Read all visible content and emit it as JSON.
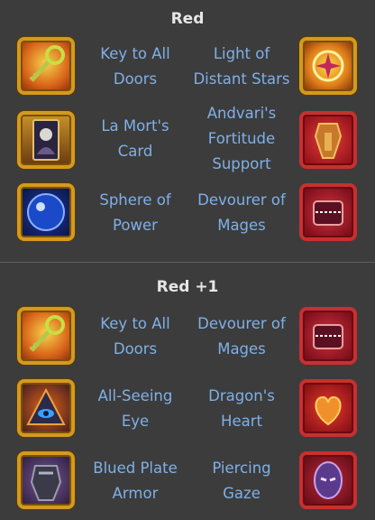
{
  "sections": [
    {
      "title": "Red",
      "rows": [
        {
          "left": {
            "name_lines": [
              "Key to All",
              "Doors"
            ],
            "icon": "key-icon"
          },
          "right": {
            "name_lines": [
              "Light of",
              "Distant Stars"
            ],
            "icon": "star-amulet-icon"
          }
        },
        {
          "left": {
            "name_lines": [
              "La Mort's",
              "Card"
            ],
            "icon": "death-card-icon"
          },
          "right": {
            "name_lines": [
              "Andvari's",
              "Fortitude",
              "Support"
            ],
            "icon": "armor-icon"
          }
        },
        {
          "left": {
            "name_lines": [
              "Sphere of",
              "Power"
            ],
            "icon": "blue-sphere-icon"
          },
          "right": {
            "name_lines": [
              "Devourer of",
              "Mages"
            ],
            "icon": "monster-chest-icon"
          }
        }
      ]
    },
    {
      "title": "Red +1",
      "rows": [
        {
          "left": {
            "name_lines": [
              "Key to All",
              "Doors"
            ],
            "icon": "key-icon"
          },
          "right": {
            "name_lines": [
              "Devourer of",
              "Mages"
            ],
            "icon": "monster-chest-icon"
          }
        },
        {
          "left": {
            "name_lines": [
              "All-Seeing",
              "Eye"
            ],
            "icon": "eye-pyramid-icon"
          },
          "right": {
            "name_lines": [
              "Dragon's",
              "Heart"
            ],
            "icon": "dragon-heart-icon"
          }
        },
        {
          "left": {
            "name_lines": [
              "Blued Plate",
              "Armor"
            ],
            "icon": "plate-armor-icon"
          },
          "right": {
            "name_lines": [
              "Piercing",
              "Gaze"
            ],
            "icon": "purple-mask-icon"
          }
        }
      ]
    }
  ],
  "colors": {
    "background": "#3c3c3c",
    "title_text": "#e6e6e6",
    "item_text": "#7fb0e8",
    "frame_gold": "#d39a1e"
  }
}
